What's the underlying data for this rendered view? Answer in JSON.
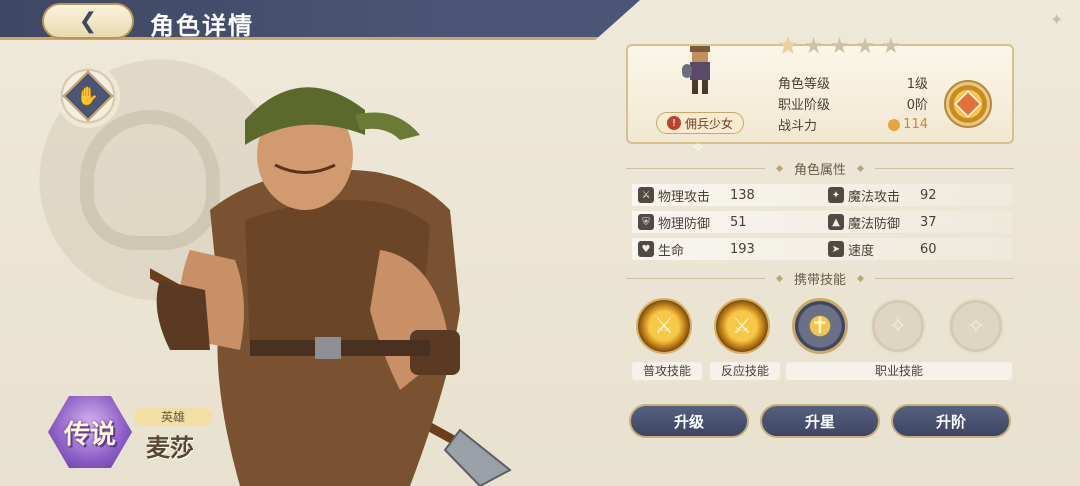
{
  "header": {
    "title": "角色详情",
    "back_icon": "chevron-left-icon"
  },
  "hero": {
    "rarity": "传说",
    "type_tag": "英雄",
    "name": "麦莎",
    "class_emblem_icon": "fist-icon"
  },
  "info": {
    "stars_total": 5,
    "stars_filled": 1,
    "class_tag": "佣兵少女",
    "rows": [
      {
        "label": "角色等级",
        "value": "1级"
      },
      {
        "label": "职业阶级",
        "value": "0阶"
      },
      {
        "label": "战斗力",
        "value": "114"
      }
    ],
    "equip_icon": "amulet-icon"
  },
  "attributes": {
    "title": "角色属性",
    "rows": [
      [
        {
          "label": "物理攻击",
          "value": "138",
          "icon": "sword-icon"
        },
        {
          "label": "魔法攻击",
          "value": "92",
          "icon": "wand-icon"
        }
      ],
      [
        {
          "label": "物理防御",
          "value": "51",
          "icon": "shield-icon"
        },
        {
          "label": "魔法防御",
          "value": "37",
          "icon": "hat-icon"
        }
      ],
      [
        {
          "label": "生命",
          "value": "193",
          "icon": "heart-icon"
        },
        {
          "label": "速度",
          "value": "60",
          "icon": "boot-icon"
        }
      ]
    ]
  },
  "skills": {
    "title": "携带技能",
    "items": [
      {
        "icon": "sword-slash-icon",
        "state": "unlocked"
      },
      {
        "icon": "sword-slash-icon",
        "state": "unlocked"
      },
      {
        "icon": "shield-crest-icon",
        "state": "unlocked"
      },
      {
        "icon": "staff-icon",
        "state": "locked"
      },
      {
        "icon": "staff-icon",
        "state": "locked"
      }
    ],
    "labels": {
      "normal": "普攻技能",
      "reaction": "反应技能",
      "job": "职业技能"
    }
  },
  "actions": {
    "level_up": "升级",
    "star_up": "升星",
    "rank_up": "升阶"
  }
}
